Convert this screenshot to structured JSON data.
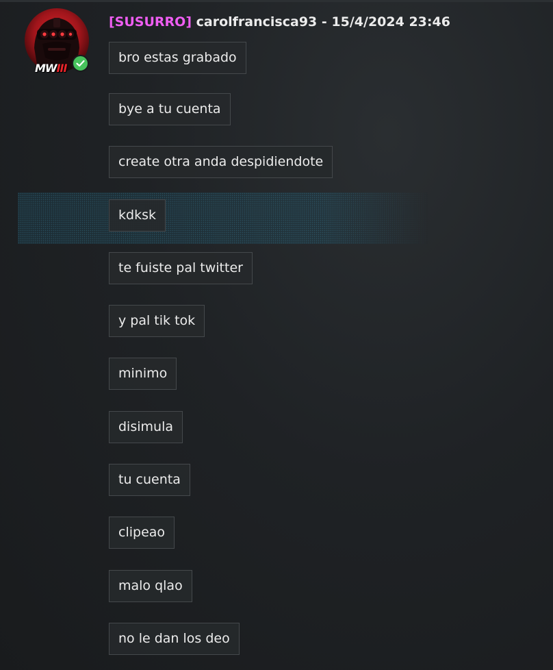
{
  "message": {
    "whisper_tag": "[SUSURRO]",
    "sender": "carolfrancisca93",
    "separator": "-",
    "timestamp": "15/4/2024 23:46",
    "avatar_logo": "MW",
    "avatar_logo_tail": "III",
    "lines": [
      "bro estas grabado",
      "bye a tu cuenta",
      "create otra anda despidiendote",
      "kdksk",
      "te fuiste pal twitter",
      "y pal tik tok",
      "minimo",
      "disimula",
      "tu cuenta",
      "clipeao",
      "malo qlao",
      "no le dan los deo"
    ]
  },
  "colors": {
    "whisper_tag": "#ef5ef2",
    "verified_badge": "#47c25c",
    "highlight": "#1e4e60",
    "avatar_red": "#d9262c"
  },
  "icons": {
    "avatar": "soldier-night-vision-goggles",
    "badge": "check-circle-icon"
  }
}
